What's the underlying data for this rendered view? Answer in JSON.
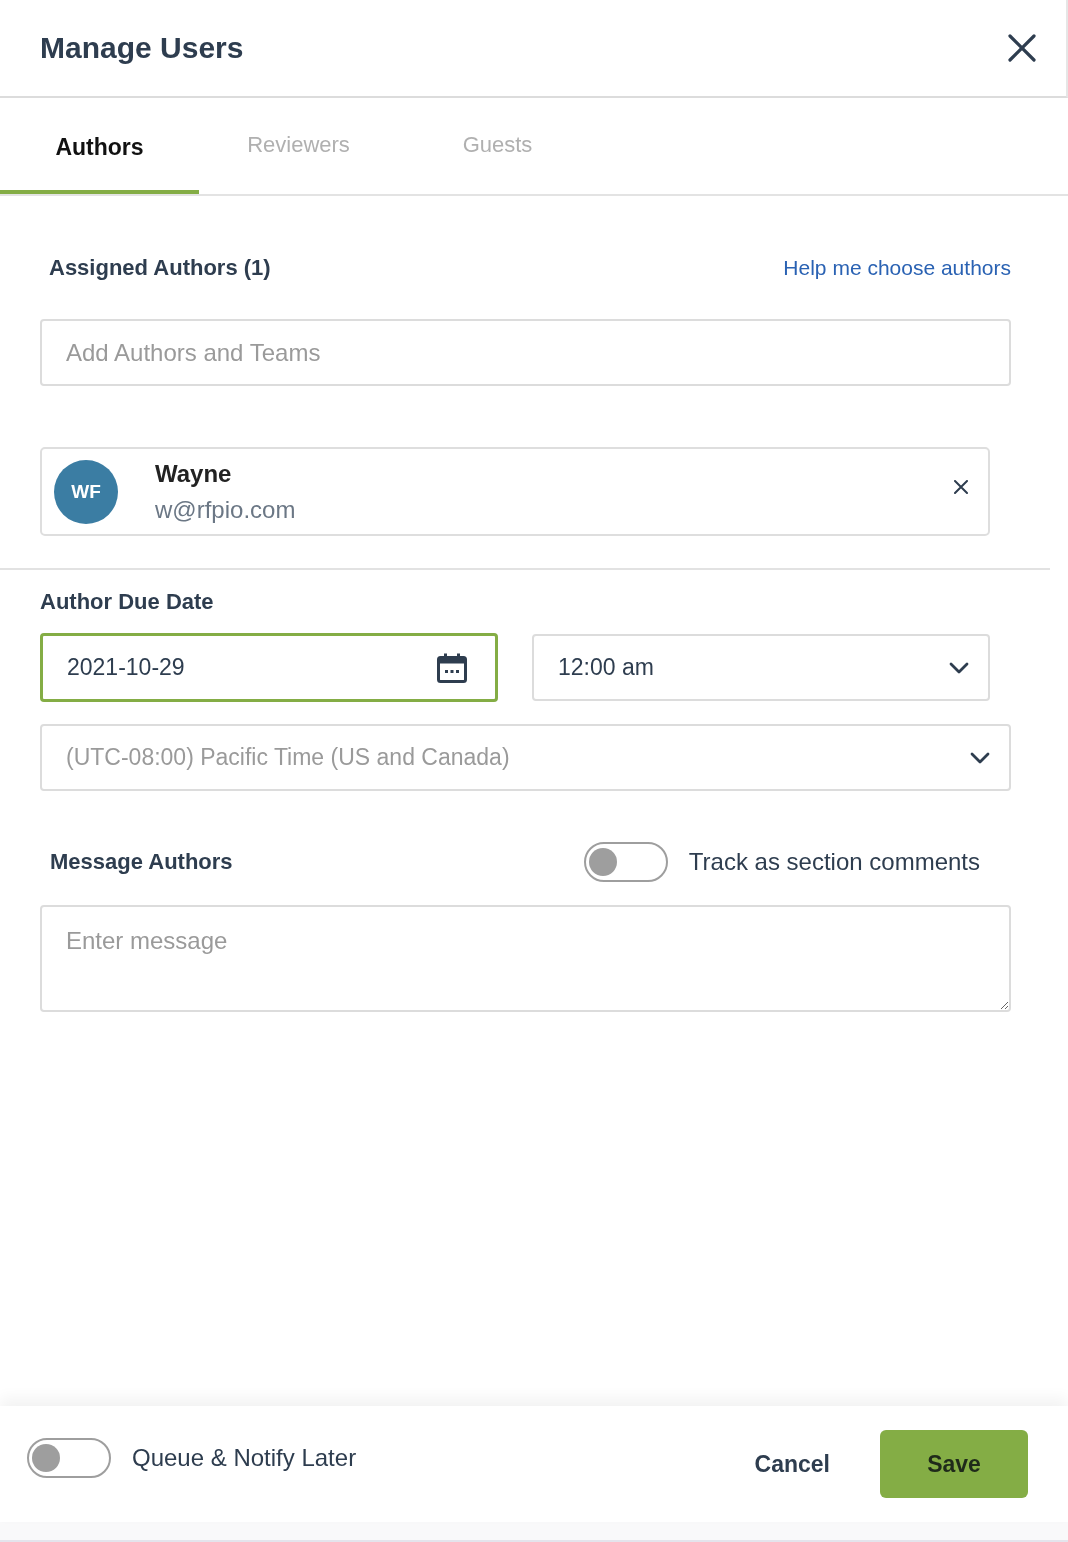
{
  "header": {
    "title": "Manage Users"
  },
  "tabs": [
    {
      "label": "Authors",
      "selected": true
    },
    {
      "label": "Reviewers",
      "selected": false
    },
    {
      "label": "Guests",
      "selected": false
    }
  ],
  "assigned": {
    "heading": "Assigned Authors (1)",
    "help_link": "Help me choose authors",
    "search": {
      "placeholder": "Add Authors and Teams"
    },
    "authors": [
      {
        "initials": "WF",
        "name": "Wayne",
        "email": "w@rfpio.com"
      }
    ]
  },
  "due_date": {
    "heading": "Author Due Date",
    "date": {
      "value": "2021-10-29",
      "focused": true
    },
    "time": {
      "value": "12:00 am"
    },
    "timezone": {
      "value": "(UTC-08:00) Pacific Time (US and Canada)",
      "disabled": true
    }
  },
  "message": {
    "heading": "Message Authors",
    "track_toggle": {
      "label": "Track as section comments",
      "on": false
    },
    "textarea": {
      "placeholder": "Enter message"
    }
  },
  "footer": {
    "queue_toggle": {
      "label": "Queue & Notify Later",
      "on": false
    },
    "buttons": [
      {
        "label": "Cancel",
        "kind": "text"
      },
      {
        "label": "Save",
        "kind": "primary"
      }
    ]
  }
}
